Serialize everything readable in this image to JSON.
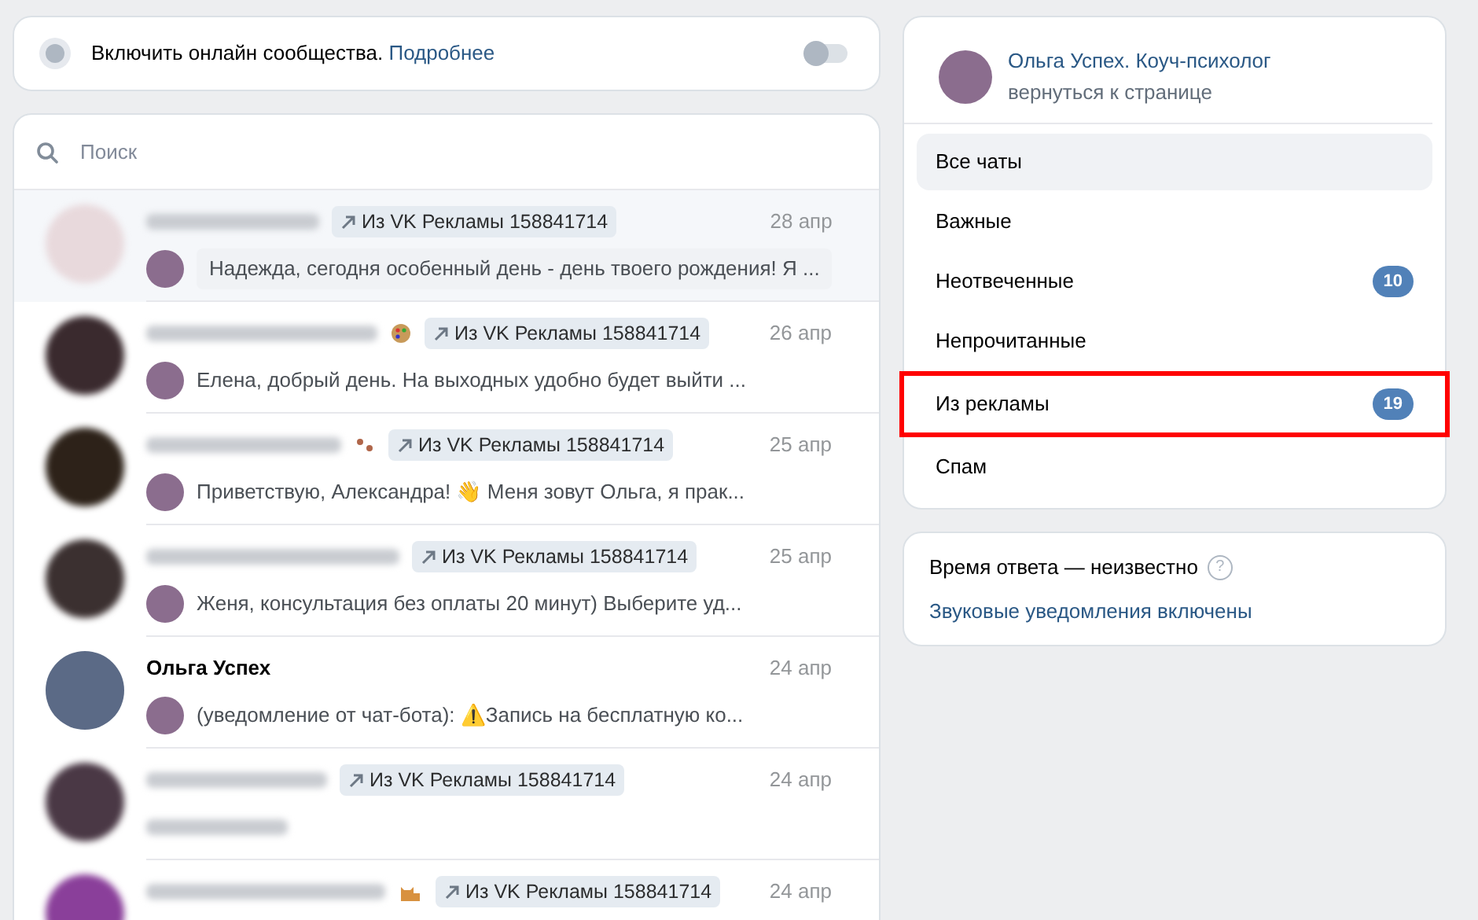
{
  "online_bar": {
    "label": "Включить онлайн сообщества.",
    "link": "Подробнее",
    "on": false
  },
  "search": {
    "placeholder": "Поиск"
  },
  "chats": [
    {
      "source": "Из VK Рекламы 158841714",
      "date": "28 апр",
      "message": "Надежда, сегодня особенный день - день твоего рождения! Я ...",
      "message_blurred": false,
      "unread": true,
      "sender_avatar": true
    },
    {
      "name_icon": {
        "kind": "palette"
      },
      "source": "Из VK Рекламы 158841714",
      "date": "26 апр",
      "message": "Елена, добрый день. На выходных удобно будет выйти ...",
      "message_blurred": false,
      "unread": false,
      "sender_avatar": true
    },
    {
      "name_icon": {
        "kind": "paws"
      },
      "source": "Из VK Рекламы 158841714",
      "date": "25 апр",
      "message": "Приветствую, Александра! 👋 Меня зовут Ольга, я прак...",
      "message_blurred": false,
      "unread": false,
      "sender_avatar": true
    },
    {
      "source": "Из VK Рекламы 158841714",
      "date": "25 апр",
      "message": "Женя, консультация без оплаты 20 минут) Выберите уд...",
      "message_blurred": false,
      "unread": false,
      "sender_avatar": true
    },
    {
      "name": "Ольга Успех",
      "date": "24 апр",
      "message": "(уведомление от чат-бота): ⚠️Запись на бесплатную ко...",
      "message_blurred": false,
      "unread": false,
      "sender_avatar": true
    },
    {
      "source": "Из VK Рекламы 158841714",
      "date": "24 апр",
      "message_blurred": true,
      "unread": false,
      "sender_avatar": false
    },
    {
      "name_icon": {
        "kind": "cat"
      },
      "source": "Из VK Рекламы 158841714",
      "date": "24 апр"
    }
  ],
  "community": {
    "name": "Ольга Успех. Коуч-психолог",
    "back_link": "вернуться к странице"
  },
  "folders": [
    {
      "label": "Все чаты",
      "selected": true,
      "highlighted": false
    },
    {
      "label": "Важные",
      "selected": false,
      "highlighted": false
    },
    {
      "label": "Неотвеченные",
      "selected": false,
      "count": "10",
      "highlighted": false
    },
    {
      "label": "Непрочитанные",
      "selected": false,
      "highlighted": false
    },
    {
      "label": "Из рекламы",
      "selected": false,
      "count": "19",
      "highlighted": true
    },
    {
      "label": "Спам",
      "selected": false,
      "highlighted": false
    }
  ],
  "info": {
    "response_time": "Время ответа — неизвестно",
    "help": "?",
    "sound_link": "Звуковые уведомления включены"
  }
}
